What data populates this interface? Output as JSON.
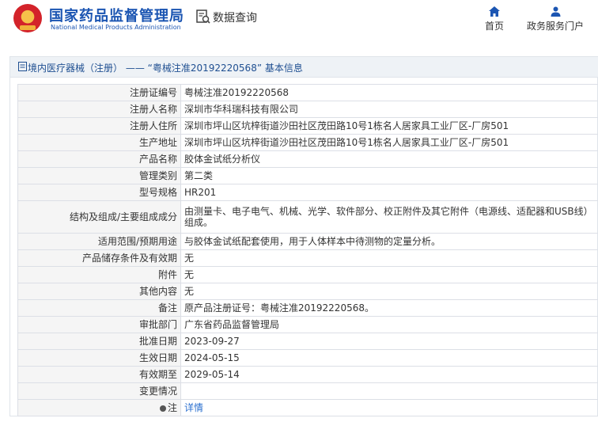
{
  "header": {
    "org_name_cn": "国家药品监督管理局",
    "org_name_en": "National Medical Products Administration",
    "data_query_label": "数据查询",
    "nav": [
      {
        "label": "首页",
        "icon": "home-icon"
      },
      {
        "label": "政务服务门户",
        "icon": "user-icon"
      }
    ]
  },
  "breadcrumb": {
    "text": "境内医疗器械（注册） —— “粤械注准20192220568” 基本信息"
  },
  "details": {
    "rows": [
      {
        "label": "注册证编号",
        "value": "粤械注准20192220568"
      },
      {
        "label": "注册人名称",
        "value": "深圳市华科瑞科技有限公司"
      },
      {
        "label": "注册人住所",
        "value": "深圳市坪山区坑梓街道沙田社区茂田路10号1栋名人居家具工业厂区-厂房501"
      },
      {
        "label": "生产地址",
        "value": "深圳市坪山区坑梓街道沙田社区茂田路10号1栋名人居家具工业厂区-厂房501"
      },
      {
        "label": "产品名称",
        "value": "胶体金试纸分析仪"
      },
      {
        "label": "管理类别",
        "value": "第二类"
      },
      {
        "label": "型号规格",
        "value": "HR201"
      },
      {
        "label": "结构及组成/主要组成成分",
        "value": "由测量卡、电子电气、机械、光学、软件部分、校正附件及其它附件（电源线、适配器和USB线）组成。"
      },
      {
        "label": "适用范围/预期用途",
        "value": "与胶体金试纸配套使用，用于人体样本中待测物的定量分析。"
      },
      {
        "label": "产品储存条件及有效期",
        "value": "无"
      },
      {
        "label": "附件",
        "value": "无"
      },
      {
        "label": "其他内容",
        "value": "无"
      },
      {
        "label": "备注",
        "value": "原产品注册证号：粤械注准20192220568。"
      },
      {
        "label": "审批部门",
        "value": "广东省药品监督管理局"
      },
      {
        "label": "批准日期",
        "value": "2023-09-27"
      },
      {
        "label": "生效日期",
        "value": "2024-05-15"
      },
      {
        "label": "有效期至",
        "value": "2029-05-14"
      },
      {
        "label": "变更情况",
        "value": ""
      },
      {
        "label": "注",
        "value": "详情"
      }
    ]
  },
  "colors": {
    "brand_blue": "#1b55b2",
    "link_blue": "#2a6fcf",
    "label_bg": "#f5f5f5",
    "border": "#dcdfe6"
  }
}
